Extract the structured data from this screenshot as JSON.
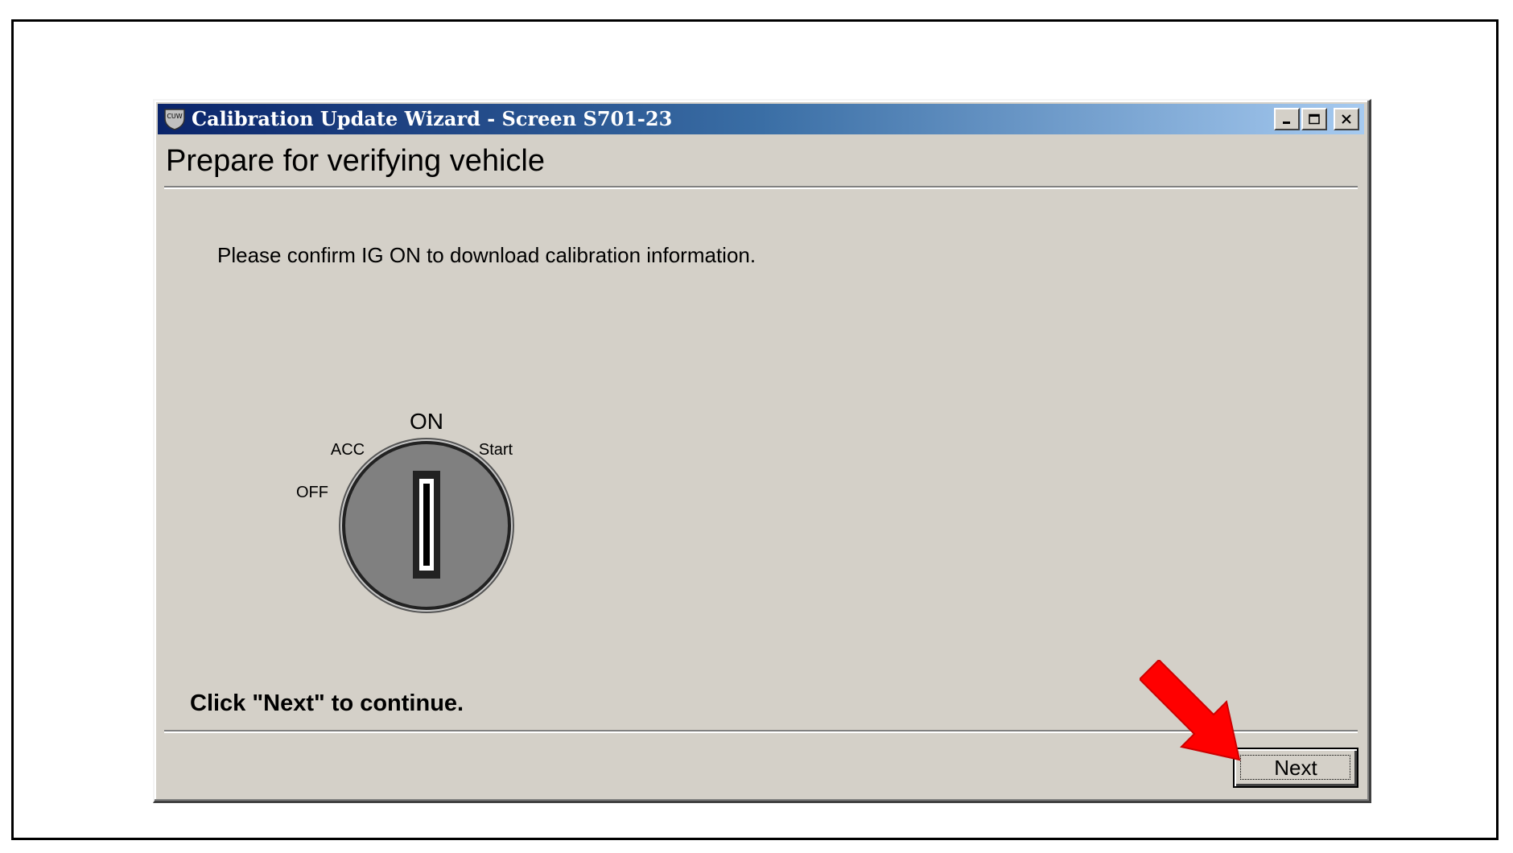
{
  "window": {
    "title": "Calibration Update Wizard - Screen S701-23",
    "app_icon_text": "CUW",
    "controls": {
      "minimize_icon": "minimize-icon",
      "maximize_icon": "maximize-icon",
      "close_icon": "close-icon"
    }
  },
  "page": {
    "title": "Prepare for verifying vehicle",
    "instruction": "Please confirm IG ON to download calibration information.",
    "continue_text": "Click \"Next\" to continue."
  },
  "key_diagram": {
    "positions": {
      "on": "ON",
      "acc": "ACC",
      "off": "OFF",
      "start": "Start"
    }
  },
  "buttons": {
    "next_label": "Next"
  },
  "colors": {
    "title_gradient_start": "#0a246a",
    "title_gradient_end": "#a6caf0",
    "dialog_bg": "#d4d0c8",
    "arrow": "#ff0000"
  }
}
